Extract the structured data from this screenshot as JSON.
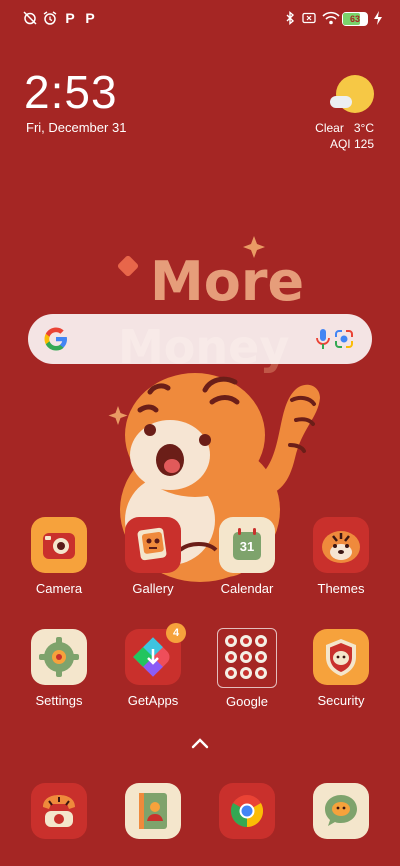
{
  "status_bar": {
    "left_icons": [
      "alarm-off-icon",
      "alarm-icon",
      "p-icon",
      "p-icon"
    ],
    "p_labels": [
      "P",
      "P"
    ],
    "right_icons": [
      "bluetooth-icon",
      "sim-icon",
      "wifi-icon",
      "battery-icon",
      "charging-icon"
    ],
    "battery_level": "63"
  },
  "clock": {
    "time": "2:53",
    "date": "Fri, December 31"
  },
  "weather": {
    "condition": "Clear",
    "temperature": "3°C",
    "aqi": "AQI 125",
    "icon": "sun-cloud-icon"
  },
  "wallpaper": {
    "text": "More",
    "text2": "Money"
  },
  "search": {
    "logo": "google-g-icon",
    "mic_icon": "mic-icon",
    "lens_icon": "lens-icon"
  },
  "apps": {
    "row1": [
      {
        "label": "Camera",
        "icon": "camera-icon"
      },
      {
        "label": "Gallery",
        "icon": "gallery-icon"
      },
      {
        "label": "Calendar",
        "icon": "calendar-icon",
        "day": "31"
      },
      {
        "label": "Themes",
        "icon": "themes-icon"
      }
    ],
    "row2": [
      {
        "label": "Settings",
        "icon": "settings-icon"
      },
      {
        "label": "GetApps",
        "icon": "getapps-icon",
        "badge": "4"
      },
      {
        "label": "Google",
        "icon": "folder-icon"
      },
      {
        "label": "Security",
        "icon": "security-icon"
      }
    ]
  },
  "dock": [
    {
      "icon": "phone-icon"
    },
    {
      "icon": "contacts-icon"
    },
    {
      "icon": "chrome-icon"
    },
    {
      "icon": "messages-icon"
    }
  ],
  "colors": {
    "background": "#a52624",
    "accent_orange": "#f6a23c",
    "cream": "#f4e6cc"
  }
}
